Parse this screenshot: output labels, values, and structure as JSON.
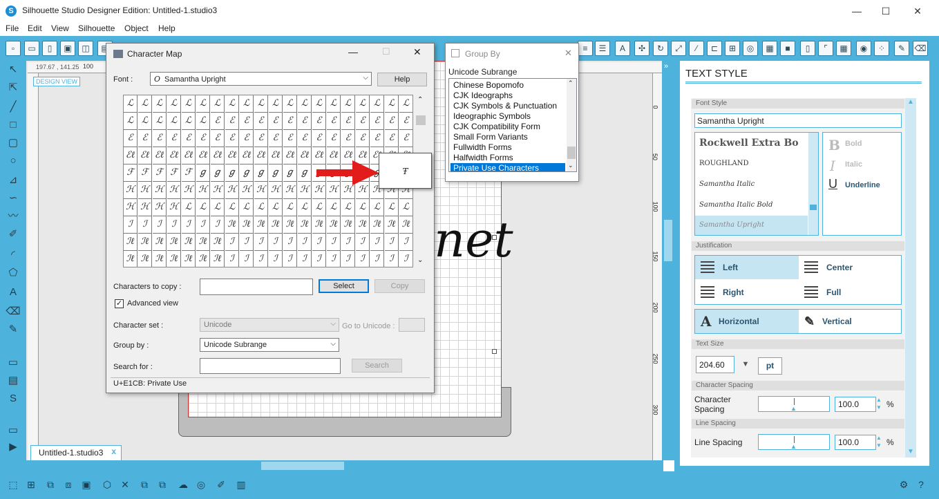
{
  "app": {
    "title": "Silhouette Studio Designer Edition: Untitled-1.studio3",
    "window_controls": {
      "minimize": "—",
      "maximize": "☐",
      "close": "✕"
    }
  },
  "menu": [
    "File",
    "Edit",
    "View",
    "Silhouette",
    "Object",
    "Help"
  ],
  "canvas": {
    "coords": "197.67 , 141.25",
    "ruler_top_label": "100",
    "design_view": "DESIGN VIEW",
    "ruler_marks": [
      "0",
      "50",
      "100",
      "150",
      "200",
      "250",
      "300"
    ],
    "text_sample": "net",
    "doc_tab": "Untitled-1.studio3",
    "doc_tab_close": "x"
  },
  "charmap": {
    "title": "Character Map",
    "font_label": "Font :",
    "font_value": "Samantha Upright",
    "help_label": "Help",
    "zoom_char": "Ŧ",
    "chars_to_copy_label": "Characters to copy :",
    "chars_to_copy_value": "",
    "select_label": "Select",
    "copy_label": "Copy",
    "advanced_view_label": "Advanced view",
    "advanced_view_checked": "✓",
    "charset_label": "Character set :",
    "charset_value": "Unicode",
    "goto_unicode_label": "Go to Unicode :",
    "groupby_label": "Group by :",
    "groupby_value": "Unicode Subrange",
    "search_label": "Search for :",
    "search_value": "",
    "search_button": "Search",
    "status": "U+E1CB: Private Use",
    "grid_rows": [
      [
        "ℒ",
        "ℒ",
        "ℒ",
        "ℒ",
        "ℒ",
        "ℒ",
        "ℒ",
        "ℒ",
        "ℒ",
        "ℒ",
        "ℒ",
        "ℒ",
        "ℒ",
        "ℒ",
        "ℒ",
        "ℒ",
        "ℒ",
        "ℒ",
        "ℒ",
        "ℒ"
      ],
      [
        "ℒ",
        "ℒ",
        "ℒ",
        "ℒ",
        "ℒ",
        "ℒ",
        "ℰ",
        "ℰ",
        "ℰ",
        "ℰ",
        "ℰ",
        "ℰ",
        "ℰ",
        "ℰ",
        "ℰ",
        "ℰ",
        "ℰ",
        "ℰ",
        "ℰ",
        "ℰ"
      ],
      [
        "ℰ",
        "ℰ",
        "ℰ",
        "ℰ",
        "ℰ",
        "ℰ",
        "ℰ",
        "ℰ",
        "ℰ",
        "ℰ",
        "ℰ",
        "ℰ",
        "ℰ",
        "ℰ",
        "ℰ",
        "ℰ",
        "ℰ",
        "ℰ",
        "ℰ",
        "ℰ"
      ],
      [
        "ℰℓ",
        "ℰℓ",
        "ℰℓ",
        "ℰℓ",
        "ℰℓ",
        "ℰℓ",
        "ℰℓ",
        "ℰℓ",
        "ℰℓ",
        "ℰℓ",
        "ℰℓ",
        "ℰℓ",
        "ℰℓ",
        "ℰℓ",
        "ℰℓ",
        "ℰℓ",
        "ℰℓ",
        "ℰℓ",
        "ℰℓ",
        "ℰℓ"
      ],
      [
        "ℱ",
        "ℱ",
        "ℱ",
        "ℱ",
        "ℱ",
        "ℊ",
        "ℊ",
        "ℊ",
        "ℊ",
        "ℊ",
        "ℊ",
        "ℊ",
        "ℊ",
        "ℊ",
        "ℊ",
        "ℊ",
        "ℊ",
        "ℊ",
        "ℊ",
        "ℊ"
      ],
      [
        "ℋ",
        "ℋ",
        "ℋ",
        "ℋ",
        "ℋ",
        "ℋ",
        "ℋ",
        "ℋ",
        "ℋ",
        "ℋ",
        "ℋ",
        "ℋ",
        "ℋ",
        "ℋ",
        "ℋ",
        "ℋ",
        "ℋ",
        "ℋ",
        "ℋ",
        "ℋ"
      ],
      [
        "ℋ",
        "ℋ",
        "ℋ",
        "ℋ",
        "ℒ",
        "ℒ",
        "ℒ",
        "ℒ",
        "ℒ",
        "ℒ",
        "ℒ",
        "ℒ",
        "ℒ",
        "ℒ",
        "ℒ",
        "ℒ",
        "ℒ",
        "ℒ",
        "ℒ",
        "ℒ"
      ],
      [
        "ℐ",
        "ℐ",
        "ℐ",
        "ℐ",
        "ℐ",
        "ℐ",
        "ℐ",
        "ℐℓ",
        "ℐℓ",
        "ℐℓ",
        "ℐℓ",
        "ℐℓ",
        "ℐℓ",
        "ℐℓ",
        "ℐℓ",
        "ℐℓ",
        "ℐℓ",
        "ℐℓ",
        "ℐℓ",
        "ℐℓ"
      ],
      [
        "ℐℓ",
        "ℐℓ",
        "ℐℓ",
        "ℐℓ",
        "ℐℓ",
        "ℐℓ",
        "ℐℓ",
        "ℐ",
        "ℐ",
        "ℐ",
        "ℐ",
        "ℐ",
        "ℐ",
        "ℐ",
        "ℐ",
        "ℐ",
        "ℐ",
        "ℐ",
        "ℐ",
        "ℐ"
      ],
      [
        "ℐℓ",
        "ℐℓ",
        "ℐℓ",
        "ℐℓ",
        "ℐℓ",
        "ℐℓ",
        "ℐℓ",
        "ℐ",
        "ℐ",
        "ℐ",
        "ℐ",
        "ℐ",
        "ℐ",
        "ℐ",
        "ℐ",
        "ℐ",
        "ℐ",
        "ℐ",
        "ℐ",
        "ℐ"
      ]
    ]
  },
  "groupby": {
    "title": "Group By",
    "close": "✕",
    "header": "Unicode Subrange",
    "items": [
      "Chinese Bopomofo",
      "CJK Ideographs",
      "CJK Symbols & Punctuation",
      "Ideographic Symbols",
      "CJK Compatibility Form",
      "Small Form Variants",
      "Fullwidth Forms",
      "Halfwidth Forms",
      "Private Use Characters"
    ],
    "selected_index": 8
  },
  "text_style": {
    "title": "TEXT STYLE",
    "font_style_label": "Font Style",
    "font_search_value": "Samantha Upright",
    "font_list": [
      "Rockwell Extra Bo",
      "ROUGHLAND",
      "Samantha Italic",
      "Samantha Italic Bold",
      "Samantha Upright"
    ],
    "style_options": {
      "bold": "Bold",
      "italic": "Italic",
      "underline": "Underline"
    },
    "justification_label": "Justification",
    "justify": {
      "left": "Left",
      "center": "Center",
      "right": "Right",
      "full": "Full"
    },
    "orientation": {
      "horizontal": "Horizontal",
      "vertical": "Vertical"
    },
    "text_size_label": "Text Size",
    "text_size_value": "204.60",
    "text_size_unit": "pt",
    "char_spacing_section": "Character Spacing",
    "char_spacing_label": "Character Spacing",
    "char_spacing_value": "100.0",
    "line_spacing_section": "Line Spacing",
    "line_spacing_label": "Line Spacing",
    "line_spacing_value": "100.0",
    "percent": "%"
  },
  "colors": {
    "accent": "#4eb3dc",
    "selection": "#0078d7",
    "arrow": "#e21b1b"
  }
}
